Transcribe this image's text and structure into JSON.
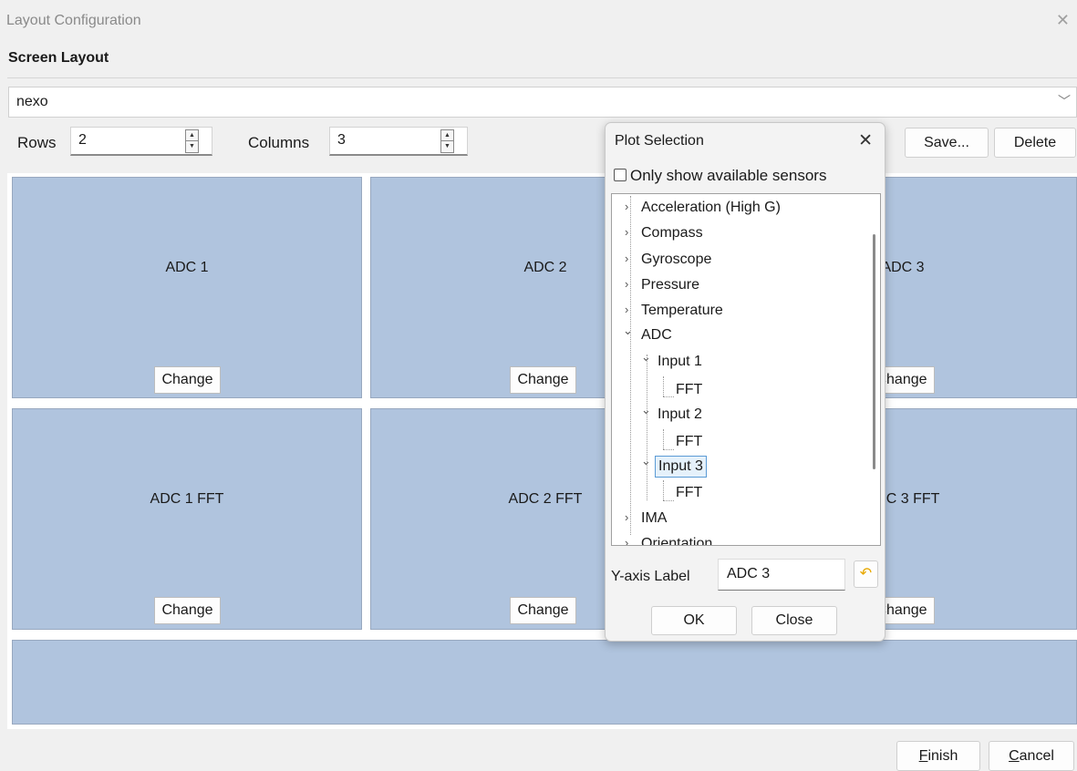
{
  "window": {
    "title": "Layout Configuration",
    "close_glyph": "✕"
  },
  "section_title": "Screen Layout",
  "layout_select": {
    "value": "nexo",
    "arrow_glyph": "﹀"
  },
  "rows": {
    "label": "Rows",
    "value": "2"
  },
  "columns": {
    "label": "Columns",
    "value": "3"
  },
  "spin_glyphs": {
    "up": "▲",
    "down": "▼"
  },
  "toolbar": {
    "save_label": "Save...",
    "delete_label": "Delete"
  },
  "grid": {
    "cells": [
      {
        "label": "ADC 1",
        "button": "Change"
      },
      {
        "label": "ADC 2",
        "button": "Change"
      },
      {
        "label": "ADC 3",
        "button": "Change"
      },
      {
        "label": "ADC 1 FFT",
        "button": "Change"
      },
      {
        "label": "ADC 2 FFT",
        "button": "Change"
      },
      {
        "label": "ADC 3 FFT",
        "button": "Change"
      }
    ]
  },
  "footer": {
    "finish_label": "Finish",
    "finish_accel": "F",
    "finish_rest": "inish",
    "cancel_label": "Cancel",
    "cancel_accel": "C",
    "cancel_rest": "ancel"
  },
  "plot_selection": {
    "title": "Plot Selection",
    "close_glyph": "✕",
    "only_available_label": "Only show available sensors",
    "only_available_checked": false,
    "tree": {
      "expander_closed": "›",
      "expander_open": "⌄",
      "items": [
        {
          "label": "Acceleration (High G)"
        },
        {
          "label": "Compass"
        },
        {
          "label": "Gyroscope"
        },
        {
          "label": "Pressure"
        },
        {
          "label": "Temperature"
        },
        {
          "label": "ADC"
        },
        {
          "label": "Input 1"
        },
        {
          "label": "FFT"
        },
        {
          "label": "Input 2"
        },
        {
          "label": "FFT"
        },
        {
          "label": "Input 3",
          "selected": true
        },
        {
          "label": "FFT"
        },
        {
          "label": "IMA"
        },
        {
          "label": "Orientation"
        }
      ]
    },
    "y_axis": {
      "label": "Y-axis Label",
      "value": "ADC 3",
      "reset_icon": "↶"
    },
    "ok_label": "OK",
    "close_label": "Close"
  },
  "colors": {
    "cell_bg": "#b0c4de",
    "window_bg": "#f0f0f0",
    "selection_border": "#5b9bd5"
  }
}
